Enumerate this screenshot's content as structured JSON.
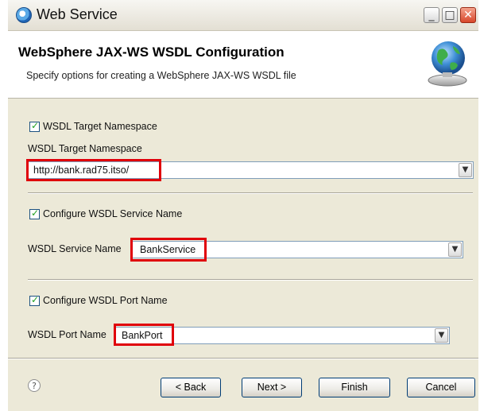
{
  "window": {
    "title": "Web Service"
  },
  "banner": {
    "title": "WebSphere JAX-WS WSDL Configuration",
    "description": "Specify options for creating a WebSphere JAX-WS WSDL file"
  },
  "namespace": {
    "checkbox_label": "WSDL Target Namespace",
    "checked": true,
    "field_label": "WSDL Target Namespace",
    "value": "http://bank.rad75.itso/"
  },
  "service_name": {
    "checkbox_label": "Configure WSDL Service Name",
    "checked": true,
    "field_label": "WSDL Service Name",
    "value": "BankService"
  },
  "port_name": {
    "checkbox_label": "Configure WSDL Port Name",
    "checked": true,
    "field_label": "WSDL Port Name",
    "value": "BankPort"
  },
  "buttons": {
    "help": "?",
    "back": "< Back",
    "next": "Next >",
    "finish": "Finish",
    "cancel": "Cancel"
  },
  "colors": {
    "highlight": "#e0000a",
    "dialog_bg": "#ece9d8"
  },
  "icons": [
    "web-service-icon",
    "minimize-icon",
    "maximize-icon",
    "close-icon",
    "globe-bell-icon",
    "help-icon",
    "dropdown-arrow-icon"
  ]
}
